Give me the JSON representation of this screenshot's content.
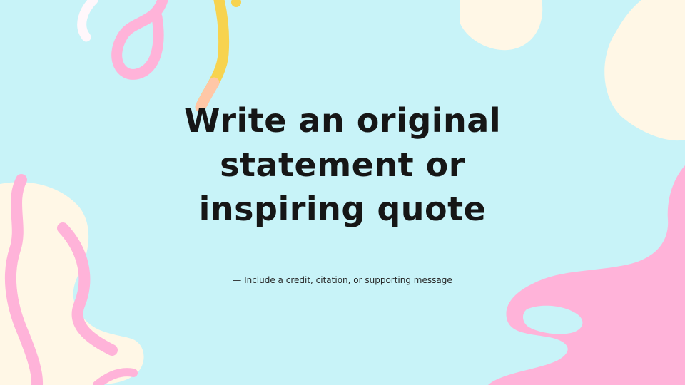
{
  "slide": {
    "quote": "Write an original statement or inspiring quote",
    "credit": "— Include a credit, citation, or supporting message"
  },
  "colors": {
    "background": "#c8f3f8",
    "cream": "#fff7e6",
    "pink": "#ffb3d9",
    "yellow": "#f7d34f",
    "peach": "#ffc7a6",
    "text": "#161616"
  }
}
